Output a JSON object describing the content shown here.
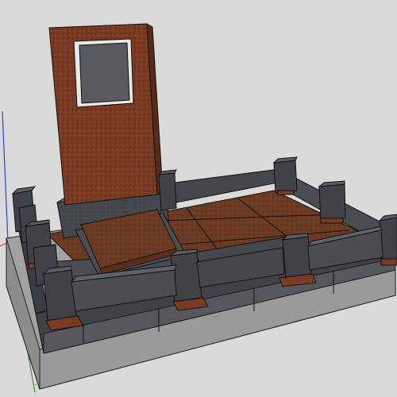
{
  "scene": {
    "description": "",
    "colors": {
      "background": "#dadada",
      "slab": "#a8a8a8",
      "granite_dark": "#3f4246",
      "granite_mid": "#55595d",
      "granite_light": "#6c7075",
      "red_granite": "#7a3b22",
      "red_granite_dark": "#5a2a17",
      "tile_brown": "#6b3a22",
      "tile_brown_light": "#7d4a2d",
      "axis_red": "#d23a3a",
      "axis_green": "#2f9a2f",
      "axis_blue": "#3a3ad2"
    },
    "axes": {
      "red": "red-axis",
      "green": "green-axis",
      "blue": "blue-axis"
    }
  }
}
